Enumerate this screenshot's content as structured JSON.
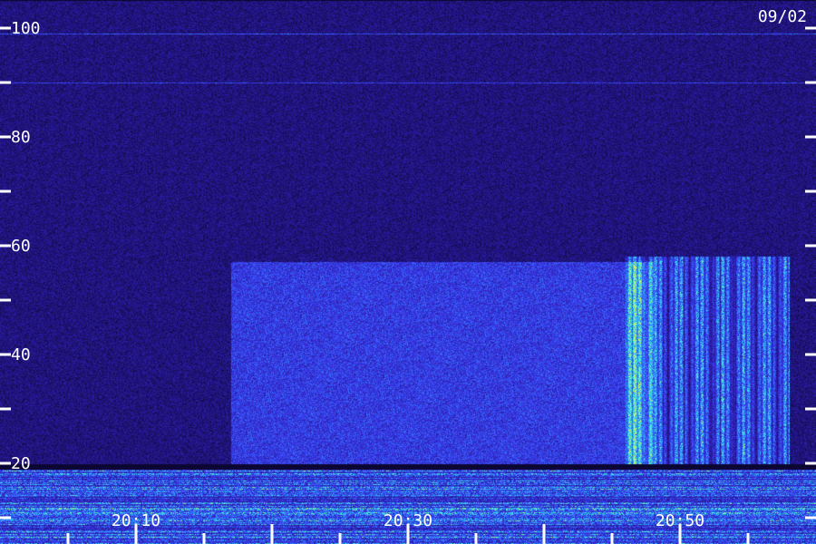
{
  "date_label": "09/02",
  "chart_data": {
    "type": "heatmap",
    "title": "",
    "xlabel": "",
    "ylabel": "",
    "x_axis": {
      "unit": "time",
      "range": [
        "20:00",
        "21:00"
      ],
      "major_tick_labels": [
        "20:10",
        "20:30",
        "20:50"
      ],
      "major_tick_minutes": [
        10,
        30,
        50
      ],
      "minor_tick_step_minutes": 5
    },
    "y_axis": {
      "range": [
        0,
        105
      ],
      "tick_values": [
        10,
        20,
        30,
        40,
        50,
        60,
        70,
        80,
        90,
        100
      ],
      "tick_labels": [
        "",
        "20",
        "",
        "40",
        "",
        "60",
        "",
        "80",
        "",
        "100"
      ]
    },
    "colormap": [
      "#0c0732",
      "#2a1aa0",
      "#3a3cf0",
      "#2f8fff",
      "#3ff0e0",
      "#d8f050"
    ],
    "features": [
      {
        "kind": "background-noise",
        "y_range": [
          20,
          105
        ],
        "level": 0.15
      },
      {
        "kind": "strong-band",
        "y_range": [
          0,
          19
        ],
        "level": 0.75
      },
      {
        "kind": "horizontal-line",
        "y": 99,
        "level": 0.3
      },
      {
        "kind": "horizontal-line",
        "y": 90,
        "level": 0.25
      },
      {
        "kind": "broadband-emission",
        "t_range": [
          "20:17",
          "20:48"
        ],
        "y_range": [
          20,
          57
        ],
        "level": 0.3
      },
      {
        "kind": "vertical-streaks",
        "t_range": [
          "20:46",
          "20:58"
        ],
        "y_range": [
          20,
          58
        ],
        "level": 0.55
      }
    ]
  }
}
